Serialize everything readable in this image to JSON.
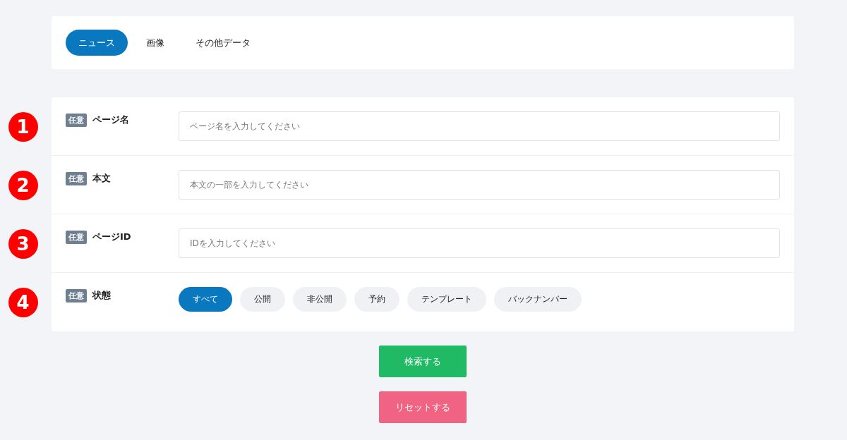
{
  "tabs": [
    {
      "label": "ニュース",
      "selected": true
    },
    {
      "label": "画像",
      "selected": false
    },
    {
      "label": "その他データ",
      "selected": false
    }
  ],
  "fields": [
    {
      "marker": "1",
      "badge": "任意",
      "label": "ページ名",
      "kind": "text",
      "placeholder": "ページ名を入力してください"
    },
    {
      "marker": "2",
      "badge": "任意",
      "label": "本文",
      "kind": "text",
      "placeholder": "本文の一部を入力してください"
    },
    {
      "marker": "3",
      "badge": "任意",
      "label": "ページID",
      "kind": "text",
      "placeholder": "IDを入力してください"
    },
    {
      "marker": "4",
      "badge": "任意",
      "label": "状態",
      "kind": "choices",
      "options": [
        {
          "label": "すべて",
          "selected": true
        },
        {
          "label": "公開",
          "selected": false
        },
        {
          "label": "非公開",
          "selected": false
        },
        {
          "label": "予約",
          "selected": false
        },
        {
          "label": "テンプレート",
          "selected": false
        },
        {
          "label": "バックナンバー",
          "selected": false
        }
      ]
    }
  ],
  "buttons": [
    {
      "label": "検索する",
      "kind": "search"
    },
    {
      "label": "リセットする",
      "kind": "reset"
    }
  ]
}
